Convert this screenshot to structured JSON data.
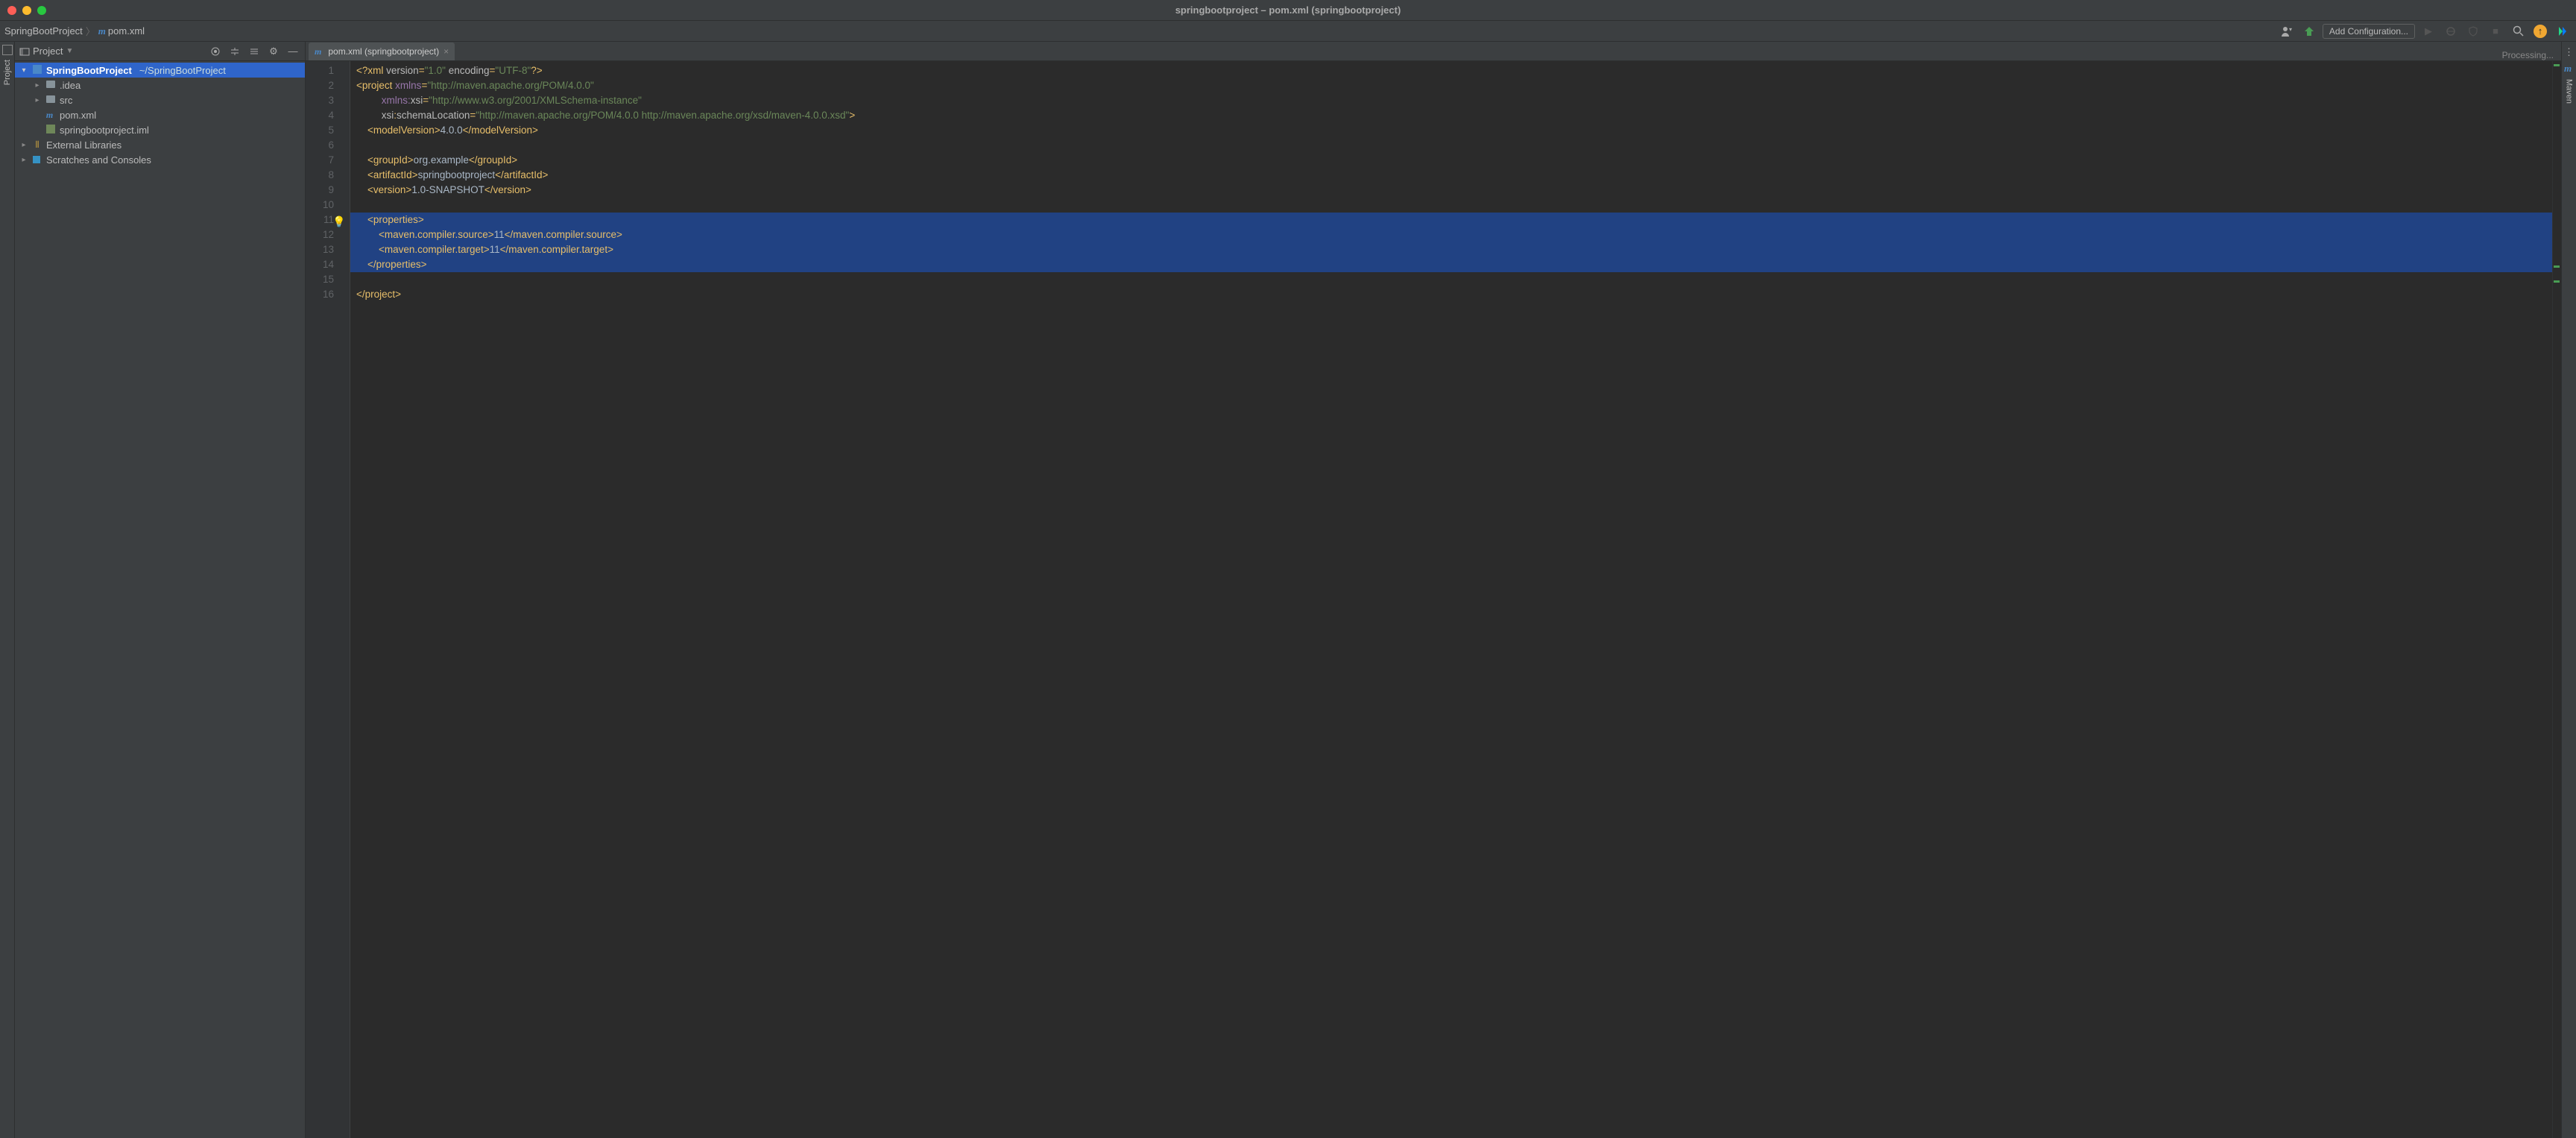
{
  "window_title": "springbootproject – pom.xml (springbootproject)",
  "breadcrumbs": {
    "project": "SpringBootProject",
    "file": "pom.xml"
  },
  "run_config": "Add Configuration...",
  "sidebar": {
    "title": "Project",
    "items": [
      {
        "name": "SpringBootProject",
        "hint": "~/SpringBootProject",
        "depth": 0,
        "arrow": "down",
        "type": "module"
      },
      {
        "name": ".idea",
        "depth": 1,
        "arrow": "right",
        "type": "folder"
      },
      {
        "name": "src",
        "depth": 1,
        "arrow": "right",
        "type": "folder"
      },
      {
        "name": "pom.xml",
        "depth": 1,
        "arrow": "",
        "type": "maven"
      },
      {
        "name": "springbootproject.iml",
        "depth": 1,
        "arrow": "",
        "type": "iml"
      },
      {
        "name": "External Libraries",
        "depth": 0,
        "arrow": "right",
        "type": "lib"
      },
      {
        "name": "Scratches and Consoles",
        "depth": 0,
        "arrow": "right",
        "type": "scratch"
      }
    ]
  },
  "tab": {
    "label": "pom.xml (springbootproject)"
  },
  "status_text": "Processing...",
  "left_gutter_label": "Project",
  "right_gutter_label": "Maven",
  "code": {
    "line_count": 16,
    "highlighted": [
      11,
      12,
      13,
      14
    ],
    "bulb_line": 11,
    "xml_version": "1.0",
    "xml_encoding": "UTF-8",
    "xmlns": "http://maven.apache.org/POM/4.0.0",
    "xmlns_xsi": "http://www.w3.org/2001/XMLSchema-instance",
    "schema_location": "http://maven.apache.org/POM/4.0.0 http://maven.apache.org/xsd/maven-4.0.0.xsd",
    "model_version": "4.0.0",
    "group_id": "org.example",
    "artifact_id": "springbootproject",
    "version": "1.0-SNAPSHOT",
    "compiler_source": "11",
    "compiler_target": "11"
  }
}
